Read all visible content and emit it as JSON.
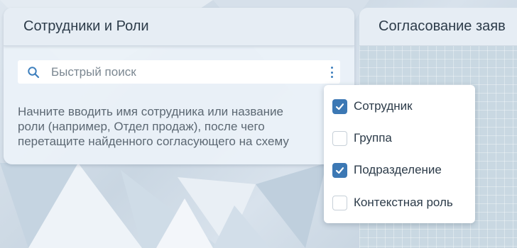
{
  "roles_panel": {
    "title": "Сотрудники и Роли",
    "search": {
      "placeholder": "Быстрый поиск",
      "value": ""
    },
    "hint": "Начните вводить имя сотрудника или название\nроли (например, Отдел продаж), после чего\nперетащите найденного согласующего на схему"
  },
  "approval_panel": {
    "title": "Согласование заяв"
  },
  "filter_menu": {
    "options": [
      {
        "label": "Сотрудник",
        "checked": true
      },
      {
        "label": "Группа",
        "checked": false
      },
      {
        "label": "Подразделение",
        "checked": true
      },
      {
        "label": "Контекстная роль",
        "checked": false
      }
    ]
  },
  "colors": {
    "accent": "#3c78b4",
    "text": "#2c3b49",
    "hint": "#5c6873"
  },
  "icons": {
    "search": "search-icon",
    "menu": "more-vertical-icon",
    "check": "check-icon"
  }
}
